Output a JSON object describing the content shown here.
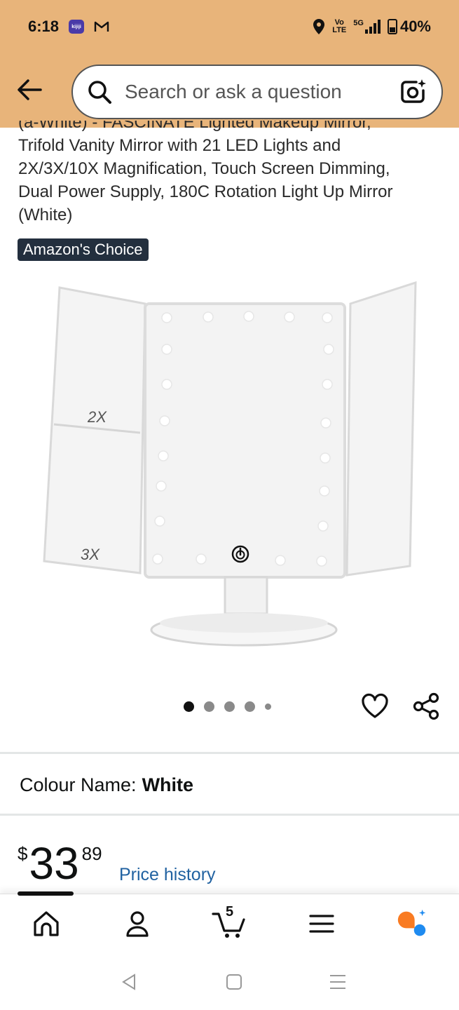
{
  "status_bar": {
    "time": "6:18",
    "app_badge": "kijiji",
    "app_icon": "gmail-icon",
    "network_top": "Vo",
    "network_bottom": "LTE",
    "signal": "5G",
    "battery": "40%"
  },
  "header": {
    "search_placeholder": "Search or ask a question"
  },
  "product": {
    "title_lines": [
      "(a-White) - FASCINATE Lighted Makeup Mirror,",
      "Trifold Vanity Mirror with 21 LED Lights and",
      "2X/3X/10X Magnification, Touch Screen Dimming,",
      "Dual Power Supply, 180C Rotation Light Up Mirror",
      "(White)"
    ],
    "badge": "Amazon's Choice",
    "image_labels": {
      "left_top": "2X",
      "left_bottom": "3X"
    },
    "carousel": {
      "count": 5,
      "active_index": 0
    }
  },
  "colour": {
    "label": "Colour Name:",
    "value": "White"
  },
  "price": {
    "currency": "$",
    "whole": "33",
    "fraction": "89",
    "history_link": "Price history"
  },
  "bottom_nav": {
    "items": [
      "home-icon",
      "account-icon",
      "cart-icon",
      "menu-icon",
      "rufus-ai-icon"
    ],
    "cart_count": "5",
    "active_index": 0
  },
  "colors": {
    "header_bg": "#e8b47a",
    "link": "#2162a1",
    "badge_bg": "#232f3e",
    "ai_orange": "#f97b22",
    "ai_blue": "#1f8bf0"
  }
}
